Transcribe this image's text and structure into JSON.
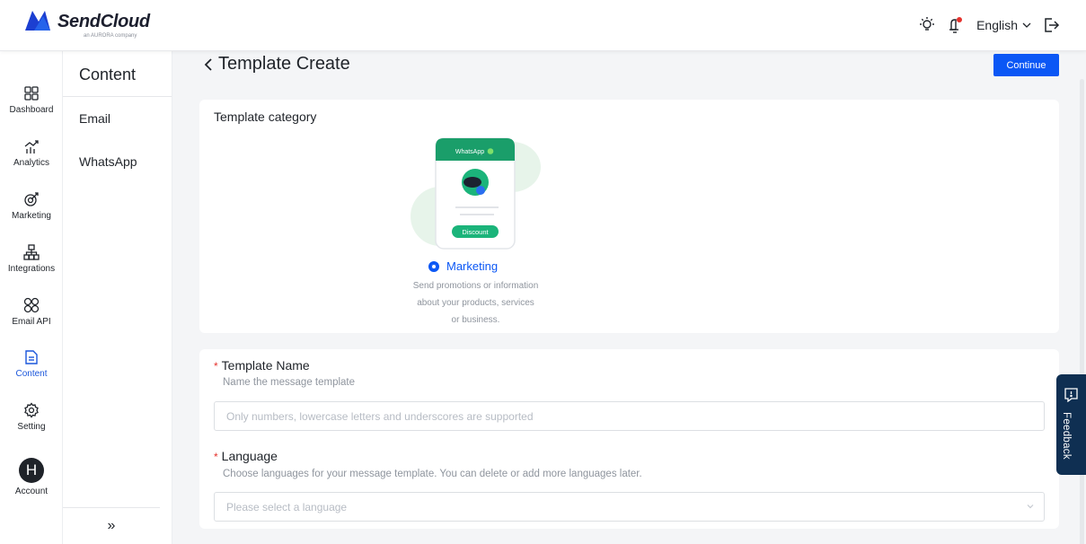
{
  "header": {
    "brand_name": "SendCloud",
    "brand_sub": "an AURORA company",
    "language": "English"
  },
  "rail": {
    "items": [
      {
        "label": "Dashboard",
        "icon": "dashboard-icon"
      },
      {
        "label": "Analytics",
        "icon": "analytics-icon"
      },
      {
        "label": "Marketing",
        "icon": "marketing-icon"
      },
      {
        "label": "Integrations",
        "icon": "integrations-icon"
      },
      {
        "label": "Email API",
        "icon": "email-api-icon"
      },
      {
        "label": "Content",
        "icon": "content-icon",
        "active": true
      },
      {
        "label": "Setting",
        "icon": "gear-icon"
      }
    ],
    "account": {
      "initial": "H",
      "label": "Account"
    }
  },
  "subnav": {
    "title": "Content",
    "items": [
      "Email",
      "WhatsApp"
    ],
    "collapse": "»"
  },
  "page": {
    "title": "Template Create",
    "continue_label": "Continue"
  },
  "category": {
    "title": "Template category",
    "illustration": {
      "header": "WhatsApp",
      "badge": "Discount"
    },
    "option_label": "Marketing",
    "option_selected": true,
    "desc_lines": [
      "Send promotions or information",
      "about your products, services",
      "or business."
    ]
  },
  "form": {
    "name_label": "Template Name",
    "name_help": "Name the message template",
    "name_placeholder": "Only numbers, lowercase letters and underscores are supported",
    "language_label": "Language",
    "language_help": "Choose languages for your message template. You can delete or add more languages later.",
    "language_placeholder": "Please select a language"
  },
  "feedback": {
    "label": "Feedback"
  },
  "colors": {
    "accent": "#0b57f5",
    "whatsapp_green": "#1bb47a",
    "feedback_bg": "#0f2f52",
    "required": "#e5322d"
  }
}
